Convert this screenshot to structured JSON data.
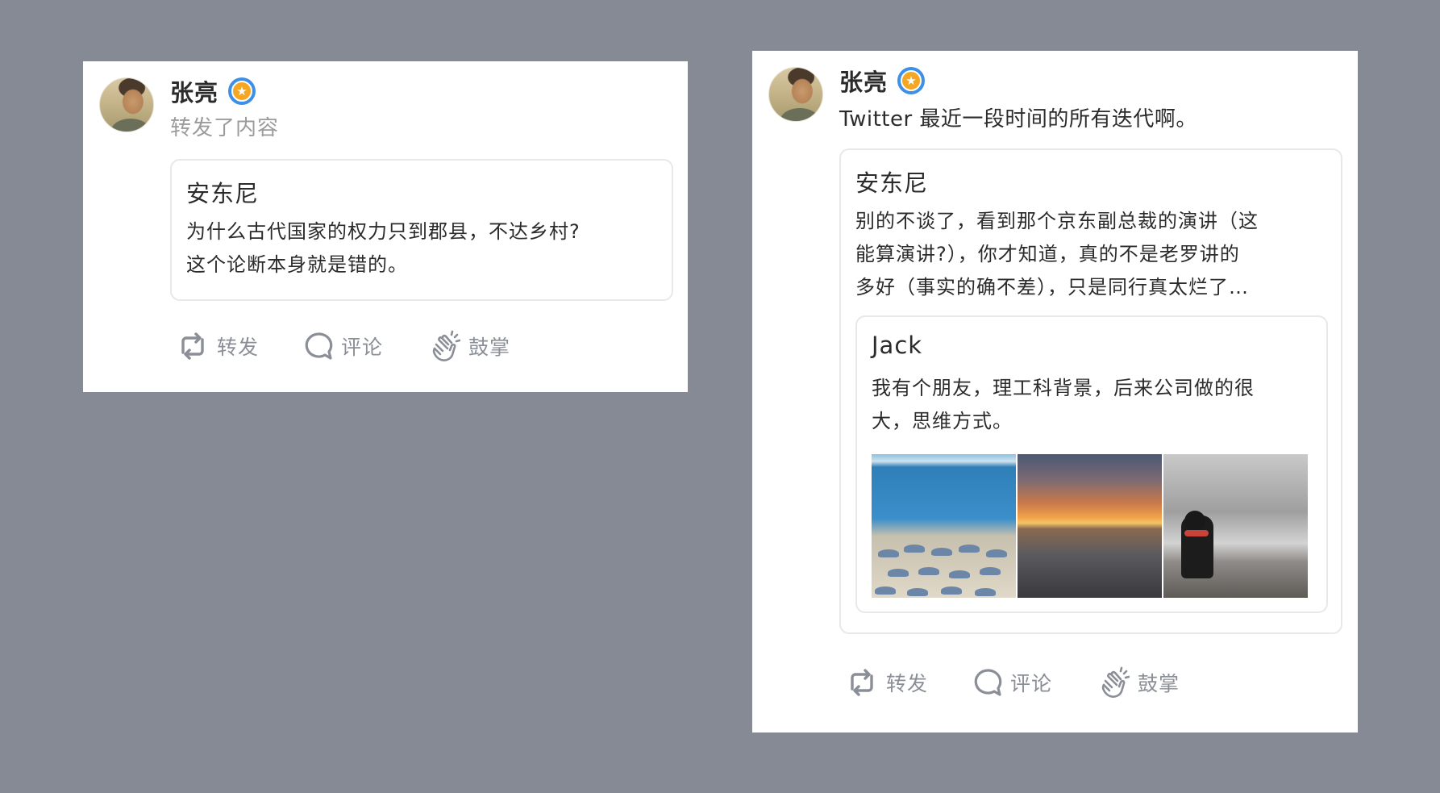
{
  "colors": {
    "background": "#868a94",
    "card": "#ffffff",
    "verified_badge_outer": "#3d8fe8",
    "verified_badge_inner": "#f5a623",
    "muted_text": "#9b9b9b",
    "action_text": "#8a8e96"
  },
  "card1": {
    "author": {
      "name": "张亮",
      "verified_icon": "verified-star-icon"
    },
    "subtitle": "转发了内容",
    "quote": {
      "author": "安东尼",
      "line1": "为什么古代国家的权力只到郡县，不达乡村?",
      "line2": "这个论断本身就是错的。"
    },
    "actions": {
      "repost": "转发",
      "comment": "评论",
      "applaud": "鼓掌"
    }
  },
  "card2": {
    "author": {
      "name": "张亮",
      "verified_icon": "verified-star-icon"
    },
    "text": "Twitter 最近一段时间的所有迭代啊。",
    "quote": {
      "author": "安东尼",
      "line1": "别的不谈了，看到那个京东副总裁的演讲（这",
      "line2": "能算演讲?），你才知道，真的不是老罗讲的",
      "line3": "多好（事实的确不差），只是同行真太烂了…",
      "nested": {
        "author": "Jack",
        "line1": "我有个朋友，理工科背景，后来公司做的很",
        "line2": "大，思维方式。",
        "photos": [
          "beach-photo",
          "sunset-photo",
          "dog-photo"
        ]
      }
    },
    "actions": {
      "repost": "转发",
      "comment": "评论",
      "applaud": "鼓掌"
    }
  }
}
